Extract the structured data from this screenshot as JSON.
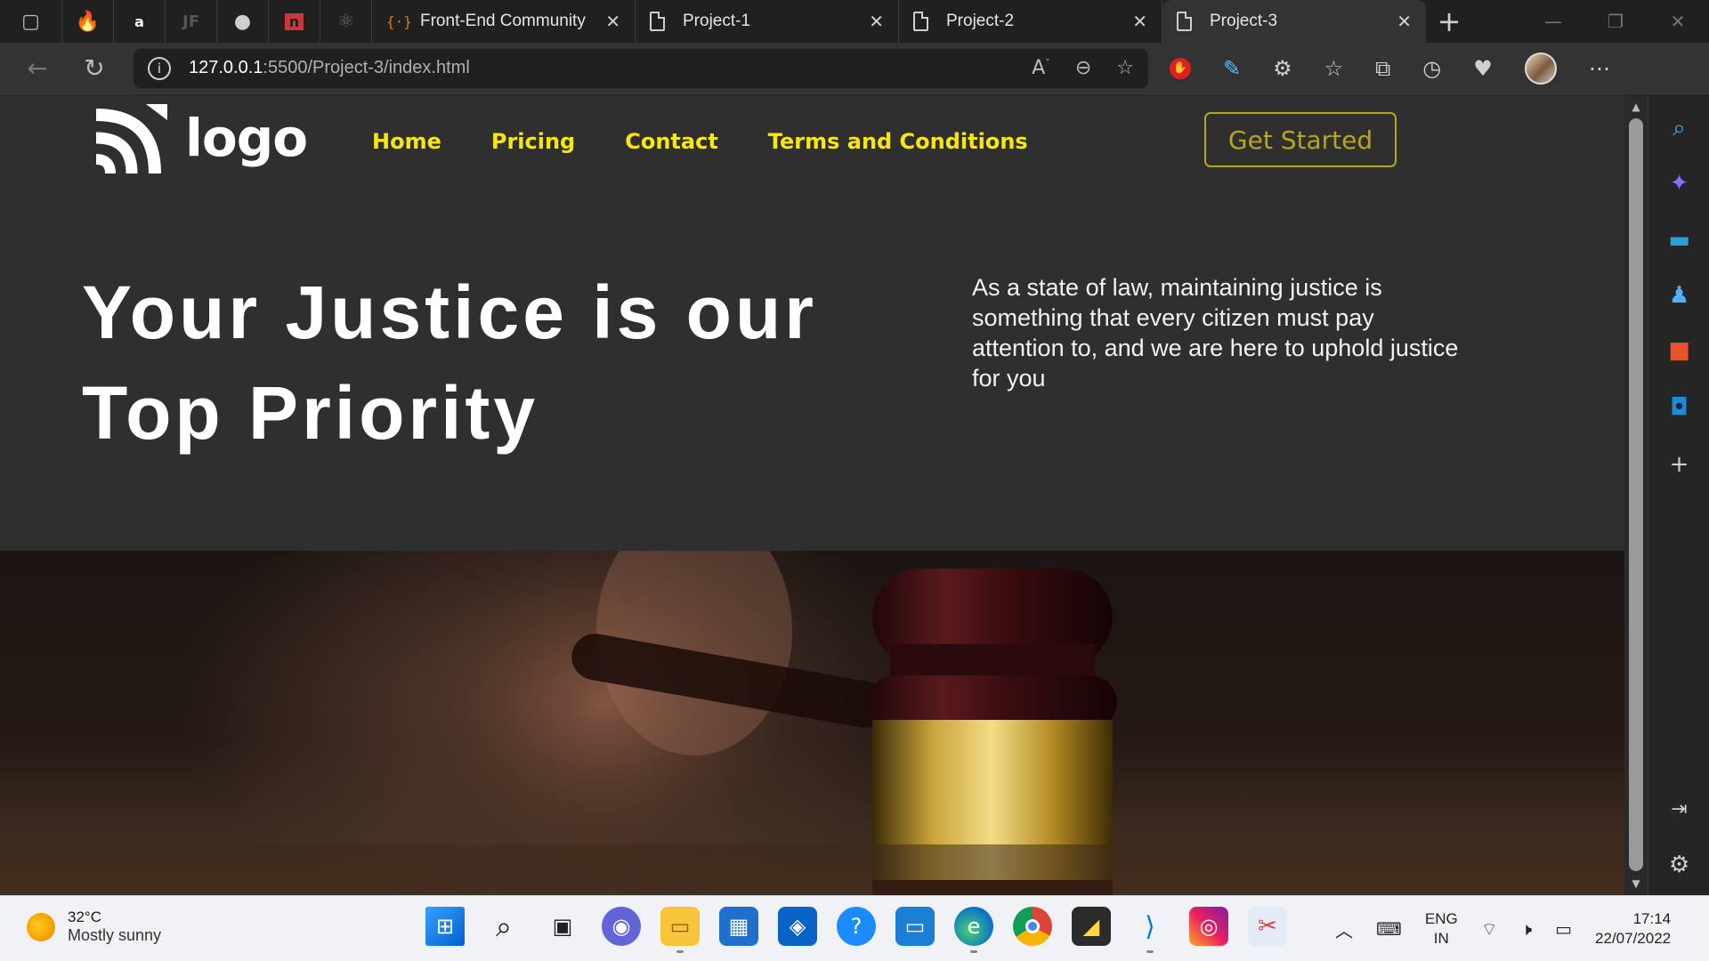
{
  "browser": {
    "pinned_tabs": [
      {
        "icon": "browser-sidebar-icon",
        "glyph": "▢"
      },
      {
        "icon": "firebase-icon",
        "glyph": "🔥"
      },
      {
        "icon": "amazon-icon",
        "glyph": "a"
      },
      {
        "icon": "jotform-icon",
        "glyph": "JF"
      },
      {
        "icon": "github-icon",
        "glyph": "●"
      },
      {
        "icon": "npm-icon",
        "glyph": "n"
      },
      {
        "icon": "react-icon",
        "glyph": "⚛"
      }
    ],
    "tabs": [
      {
        "label": "Front-End Community",
        "icon": "code-braces-icon",
        "icon_glyph": "{·}",
        "active": false
      },
      {
        "label": "Project-1",
        "icon": "document-icon",
        "active": false
      },
      {
        "label": "Project-2",
        "icon": "document-icon",
        "active": false
      },
      {
        "label": "Project-3",
        "icon": "document-icon",
        "active": true
      }
    ],
    "address": {
      "host": "127.0.0.1",
      "path": ":5500/Project-3/index.html"
    }
  },
  "site": {
    "logo_text": "logo",
    "nav": [
      "Home",
      "Pricing",
      "Contact",
      "Terms and Conditions"
    ],
    "cta_label": "Get Started",
    "hero_title": "Your Justice is our Top Priority",
    "hero_text": "As a state of law, maintaining justice is something that every citizen must pay attention to, and we are here to uphold justice for you",
    "colors": {
      "accent": "#f6e614",
      "cta_border": "#b7a614",
      "background": "#2f2f2f"
    }
  },
  "taskbar": {
    "weather": {
      "temp": "32°C",
      "desc": "Mostly sunny"
    },
    "lang": {
      "line1": "ENG",
      "line2": "IN"
    },
    "clock": {
      "time": "17:14",
      "date": "22/07/2022"
    }
  }
}
